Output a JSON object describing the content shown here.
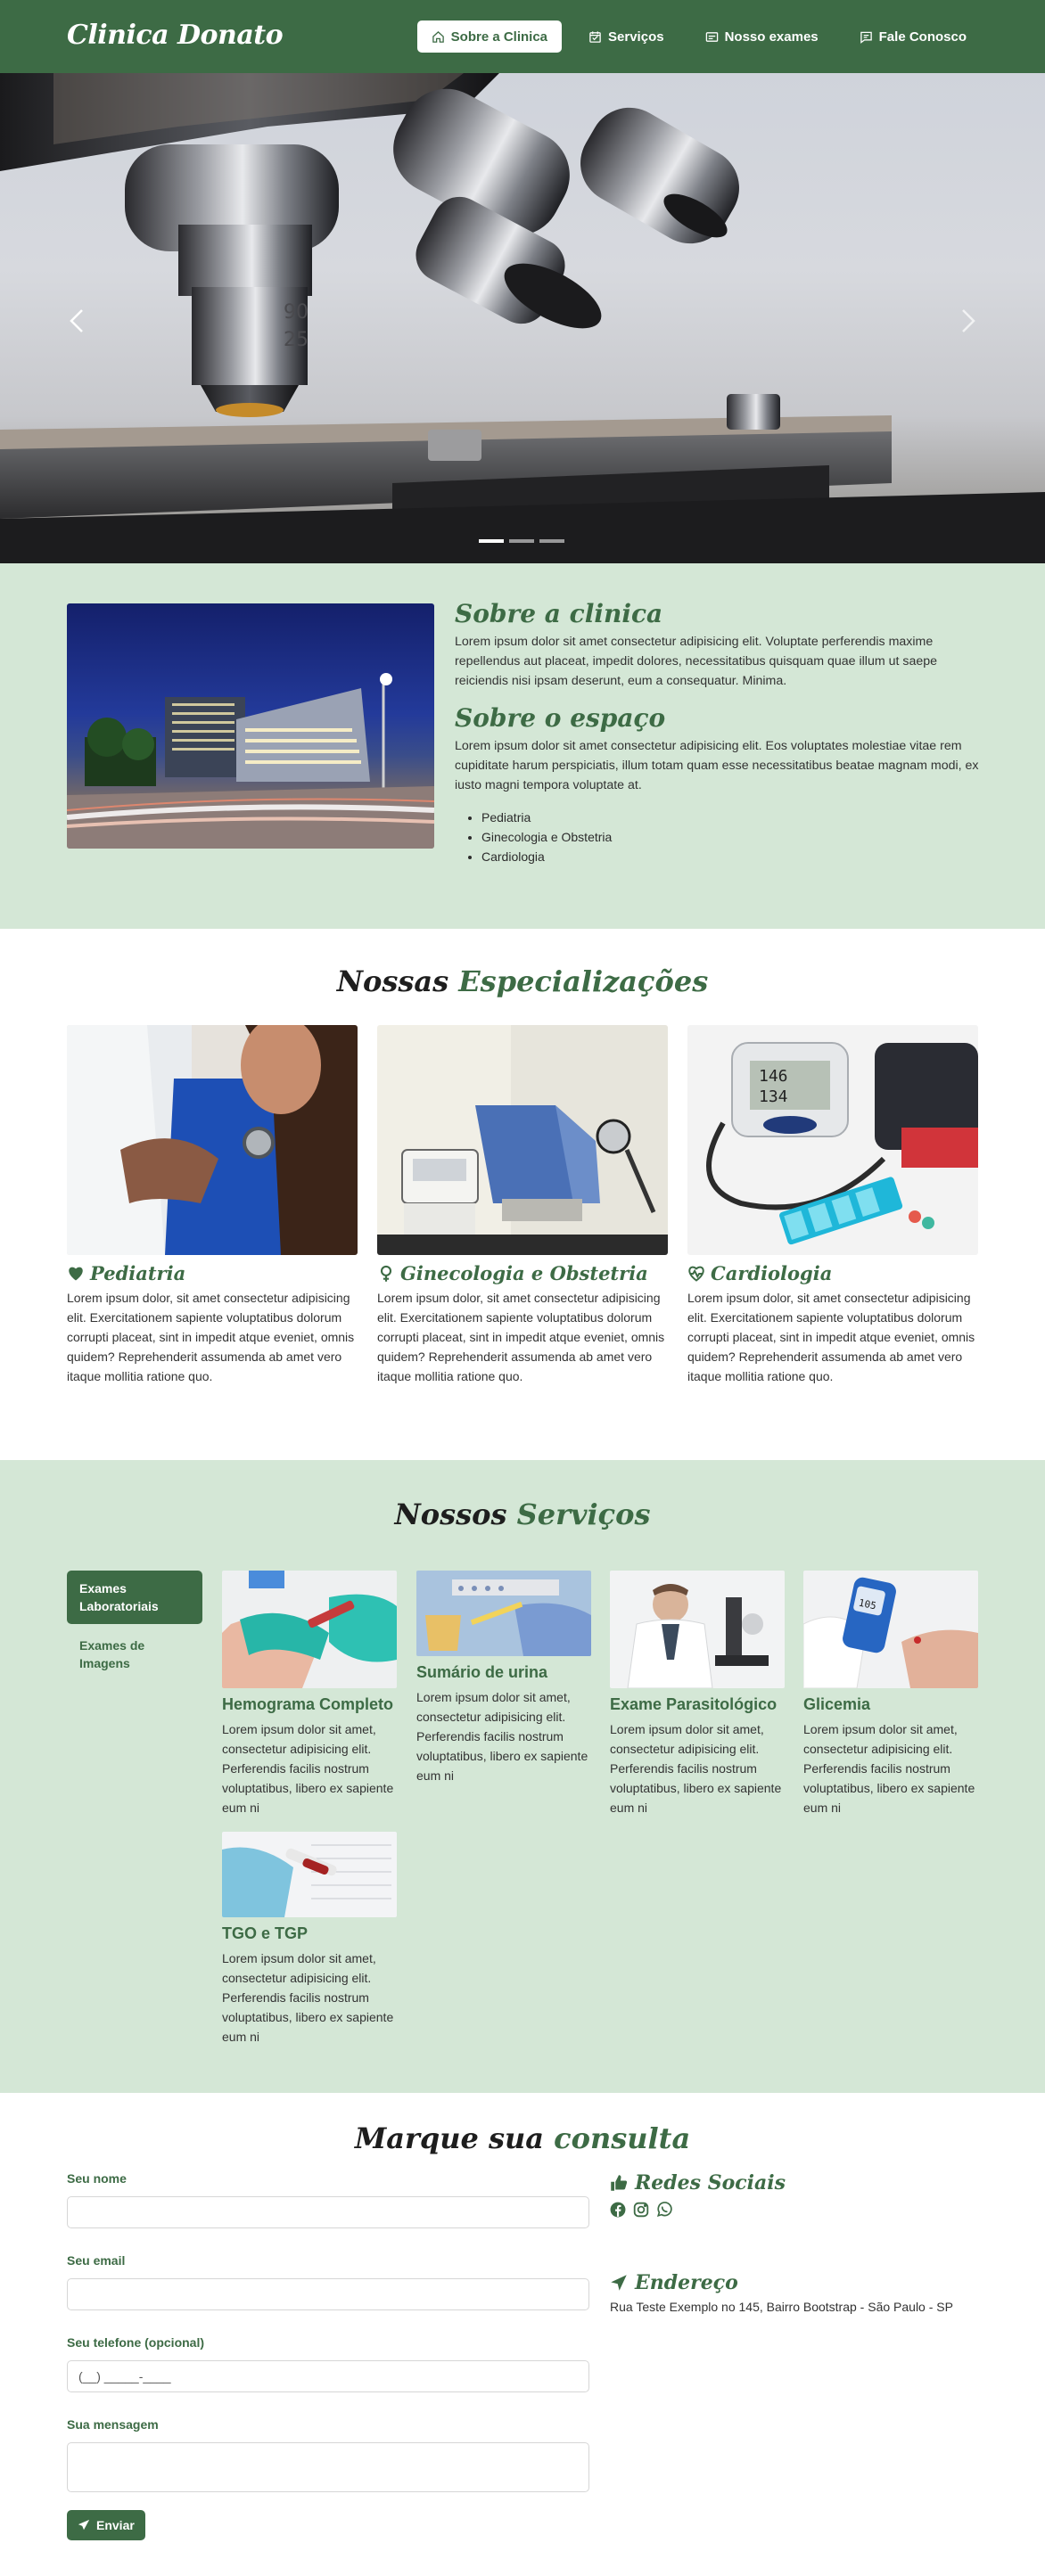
{
  "navbar": {
    "brand": "Clinica Donato",
    "items": [
      {
        "label": "Sobre a Clinica",
        "icon": "home-icon",
        "active": true
      },
      {
        "label": "Serviços",
        "icon": "calendar-icon"
      },
      {
        "label": "Nosso exames",
        "icon": "card-icon"
      },
      {
        "label": "Fale Conosco",
        "icon": "chat-icon"
      }
    ]
  },
  "hero": {
    "image": "microscope-photo",
    "slides": 3,
    "active_slide": 1,
    "objective_labels": [
      "90",
      "25"
    ]
  },
  "sobre": {
    "title1": "Sobre a clinica",
    "text1": "Lorem ipsum dolor sit amet consectetur adipisicing elit. Voluptate perferendis maxime repellendus aut placeat, impedit dolores, necessitatibus quisquam quae illum ut saepe reiciendis nisi ipsam deserunt, eum a consequatur. Minima.",
    "title2": "Sobre o espaço",
    "text2": "Lorem ipsum dolor sit amet consectetur adipisicing elit. Eos voluptates molestiae vitae rem cupiditate harum perspiciatis, illum totam quam esse necessitatibus beatae magnam modi, ex iusto magni tempora voluptate at.",
    "list": [
      "Pediatria",
      "Ginecologia e Obstetria",
      "Cardiologia"
    ]
  },
  "especializacoes": {
    "title_a": "Nossas",
    "title_b": "Especializações",
    "cards": [
      {
        "title": "Pediatria",
        "icon": "heart-icon",
        "text": "Lorem ipsum dolor, sit amet consectetur adipisicing elit. Exercitationem sapiente voluptatibus dolorum corrupti placeat, sint in impedit atque eveniet, omnis quidem? Reprehenderit assumenda ab amet vero itaque mollitia ratione quo."
      },
      {
        "title": "Ginecologia e Obstetria",
        "icon": "female-icon",
        "text": "Lorem ipsum dolor, sit amet consectetur adipisicing elit. Exercitationem sapiente voluptatibus dolorum corrupti placeat, sint in impedit atque eveniet, omnis quidem? Reprehenderit assumenda ab amet vero itaque mollitia ratione quo."
      },
      {
        "title": "Cardiologia",
        "icon": "heart-pulse-icon",
        "text": "Lorem ipsum dolor, sit amet consectetur adipisicing elit. Exercitationem sapiente voluptatibus dolorum corrupti placeat, sint in impedit atque eveniet, omnis quidem? Reprehenderit assumenda ab amet vero itaque mollitia ratione quo."
      }
    ],
    "monitor_readout": [
      "146",
      "134"
    ]
  },
  "servicos": {
    "title_a": "Nossos",
    "title_b": "Serviços",
    "tabs": [
      {
        "label": "Exames Laboratoriais",
        "active": true
      },
      {
        "label": "Exames de Imagens",
        "active": false
      }
    ],
    "cards": [
      {
        "title": "Hemograma Completo",
        "text": "Lorem ipsum dolor sit amet, consectetur adipisicing elit. Perferendis facilis nostrum voluptatibus, libero ex sapiente eum ni"
      },
      {
        "title": "Sumário de urina",
        "text": "Lorem ipsum dolor sit amet, consectetur adipisicing elit. Perferendis facilis nostrum voluptatibus, libero ex sapiente eum ni"
      },
      {
        "title": "Exame Parasitológico",
        "text": "Lorem ipsum dolor sit amet, consectetur adipisicing elit. Perferendis facilis nostrum voluptatibus, libero ex sapiente eum ni"
      },
      {
        "title": "Glicemia",
        "text": "Lorem ipsum dolor sit amet, consectetur adipisicing elit. Perferendis facilis nostrum voluptatibus, libero ex sapiente eum ni"
      },
      {
        "title": "TGO e TGP",
        "text": "Lorem ipsum dolor sit amet, consectetur adipisicing elit. Perferendis facilis nostrum voluptatibus, libero ex sapiente eum ni"
      }
    ],
    "glucose_readout": "105"
  },
  "consulta": {
    "title_a": "Marque sua",
    "title_b": "consulta",
    "form": {
      "name_label": "Seu nome",
      "email_label": "Seu email",
      "phone_label": "Seu telefone (opcional)",
      "phone_value": "(__) _____-____",
      "message_label": "Sua mensagem",
      "submit_label": "Enviar"
    },
    "social_title": "Redes Sociais",
    "social_icons": [
      "facebook-icon",
      "instagram-icon",
      "whatsapp-icon"
    ],
    "address_title": "Endereço",
    "address": "Rua Teste Exemplo no 145, Bairro Bootstrap - São Paulo - SP"
  },
  "colors": {
    "primary": "#3d6b45",
    "section_bg": "#d4e7d6"
  }
}
